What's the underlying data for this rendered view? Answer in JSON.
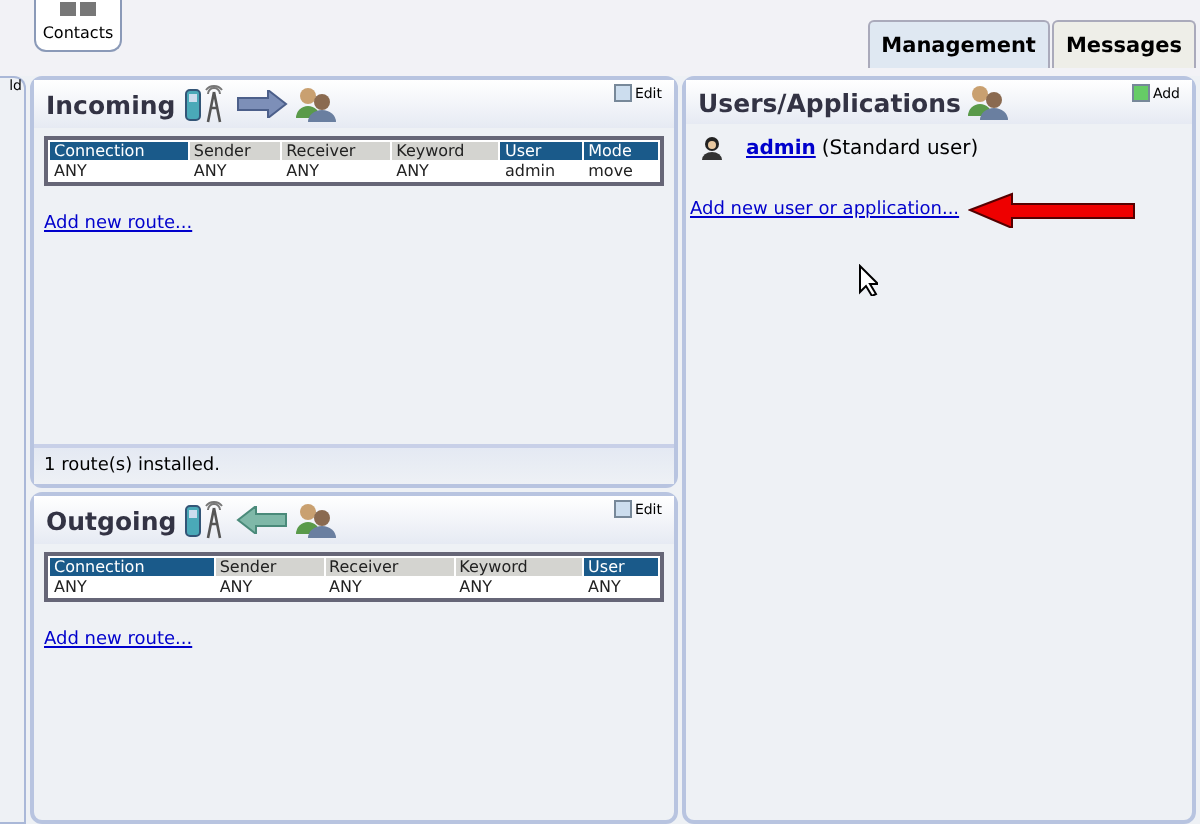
{
  "toolbar": {
    "contacts_button": "Contacts"
  },
  "left_strip": {
    "text": "ld"
  },
  "tabs": [
    {
      "label": "Management",
      "selected": true
    },
    {
      "label": "Messages",
      "selected": false
    }
  ],
  "incoming": {
    "title": "Incoming",
    "edit": "Edit",
    "columns": [
      {
        "label": "Connection",
        "selected": true
      },
      {
        "label": "Sender",
        "selected": false
      },
      {
        "label": "Receiver",
        "selected": false
      },
      {
        "label": "Keyword",
        "selected": false
      },
      {
        "label": "User",
        "selected": true
      },
      {
        "label": "Mode",
        "selected": true
      }
    ],
    "rows": [
      [
        "ANY",
        "ANY",
        "ANY",
        "ANY",
        "admin",
        "move"
      ]
    ],
    "add_link": "Add new route...",
    "footer": "1 route(s) installed."
  },
  "outgoing": {
    "title": "Outgoing",
    "edit": "Edit",
    "columns": [
      {
        "label": "Connection",
        "selected": true
      },
      {
        "label": "Sender",
        "selected": false
      },
      {
        "label": "Receiver",
        "selected": false
      },
      {
        "label": "Keyword",
        "selected": false
      },
      {
        "label": "User",
        "selected": true
      }
    ],
    "rows": [
      [
        "ANY",
        "ANY",
        "ANY",
        "ANY",
        "ANY"
      ]
    ],
    "add_link": "Add new route..."
  },
  "users": {
    "title": "Users/Applications",
    "add": "Add",
    "items": [
      {
        "name": "admin",
        "role": "(Standard user)"
      }
    ],
    "add_link": "Add new user or application..."
  }
}
